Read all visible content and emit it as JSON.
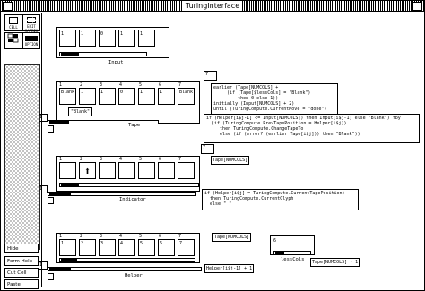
{
  "window": {
    "title": "TuringInterface"
  },
  "tools": [
    {
      "label": "CELL"
    },
    {
      "label": "EDIT\nMATRIX"
    },
    {
      "label": ""
    },
    {
      "label": "OPTION"
    }
  ],
  "left_buttons": [
    "Hide",
    "Form Help",
    "Cut Cell",
    "Paste"
  ],
  "input": {
    "label": "Input",
    "cells": [
      "1",
      "1",
      "0",
      "1",
      "1"
    ]
  },
  "tape": {
    "label": "Tape",
    "row_label": "1",
    "counter": "7",
    "indices": [
      "1",
      "2",
      "3",
      "4",
      "5",
      "6",
      "7"
    ],
    "cells": [
      "Blank",
      "1",
      "1",
      "0",
      "1",
      "1",
      "Blank"
    ],
    "selected_value": "\"Blank\"",
    "formula1": "earlier (Tape[NUMCOLS] +\n     (if (Tape[$lessCols] = \"Blank\")\n         then 0 else 1))\ninitially (Input[NUMCOLS] + 2)\nuntil (TuringCompute.CurrentMove = \"done\")",
    "formula2": "if (Helper[i$j-1] <= Input[NUMCOLS]) then Input[i$j-1] else \"Blank\") fby\n  (if (TuringCompute.PrevTapePosition = Helper[i$j])\n     then TuringCompute.ChangeTapeTo\n     else (if (error? (earlier Tape[i$j])) then \"Blank\"))"
  },
  "indicator": {
    "label": "Indicator",
    "row_label": "1",
    "counter": "7",
    "indices": [
      "1",
      "2",
      "3",
      "4",
      "5",
      "6",
      "7"
    ],
    "head_symbol": "⬆",
    "head_index": 1,
    "formula_top": "Tape[NUMCOLS]",
    "formula": "if (Helper[i$j] = TuringCompute.CurrentTapePosition)\n  then TuringCompute.CurrentGlyph\n  else \" \""
  },
  "helper": {
    "label": "Helper",
    "row_label": "1",
    "counter": "",
    "indices": [
      "1",
      "2",
      "3",
      "4",
      "5",
      "6",
      "7"
    ],
    "cells": [
      "1",
      "2",
      "3",
      "4",
      "5",
      "6",
      "7"
    ],
    "formula_top": "Tape[NUMCOLS]",
    "formula": "Helper[i$j-1] + 1"
  },
  "lesscols": {
    "label": "lessCols",
    "value": "6",
    "formula": "Tape[NUMCOLS] - 1"
  }
}
